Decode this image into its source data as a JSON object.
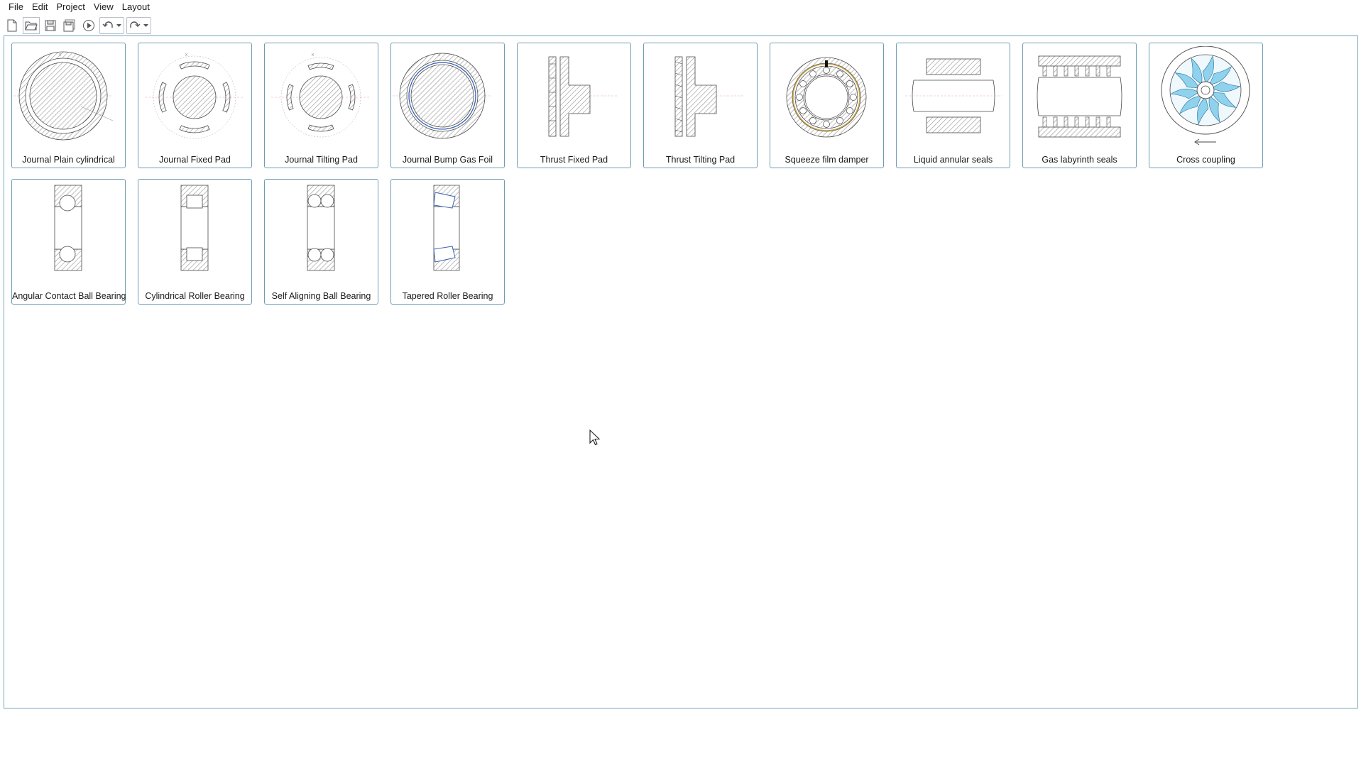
{
  "menu": {
    "file": "File",
    "edit": "Edit",
    "project": "Project",
    "view": "View",
    "layout": "Layout"
  },
  "toolbar": {
    "icons": [
      "new-file-icon",
      "open-folder-icon",
      "save-icon",
      "save-all-icon",
      "run-icon",
      "undo-icon",
      "redo-icon"
    ]
  },
  "tiles": [
    {
      "label": "Journal Plain cylindrical",
      "kind": "journal-plain"
    },
    {
      "label": "Journal Fixed Pad",
      "kind": "journal-fixed"
    },
    {
      "label": "Journal Tilting Pad",
      "kind": "journal-tilting"
    },
    {
      "label": "Journal Bump Gas Foil",
      "kind": "journal-foil"
    },
    {
      "label": "Thrust Fixed Pad",
      "kind": "thrust-fixed"
    },
    {
      "label": "Thrust Tilting Pad",
      "kind": "thrust-tilting"
    },
    {
      "label": "Squeeze film damper",
      "kind": "squeeze"
    },
    {
      "label": "Liquid annular seals",
      "kind": "annular-seal"
    },
    {
      "label": "Gas labyrinth seals",
      "kind": "labyrinth"
    },
    {
      "label": "Cross coupling",
      "kind": "cross-coupling"
    },
    {
      "label": "Angular Contact Ball Bearing",
      "kind": "angular-ball"
    },
    {
      "label": "Cylindrical Roller Bearing",
      "kind": "cyl-roller"
    },
    {
      "label": "Self Aligning Ball Bearing",
      "kind": "self-align"
    },
    {
      "label": "Tapered Roller Bearing",
      "kind": "tapered"
    }
  ],
  "colors": {
    "border": "#6f9cb3",
    "line": "#4a4a4a",
    "accent_blue": "#3a62b3",
    "fan_blue": "#8fd2ee"
  }
}
